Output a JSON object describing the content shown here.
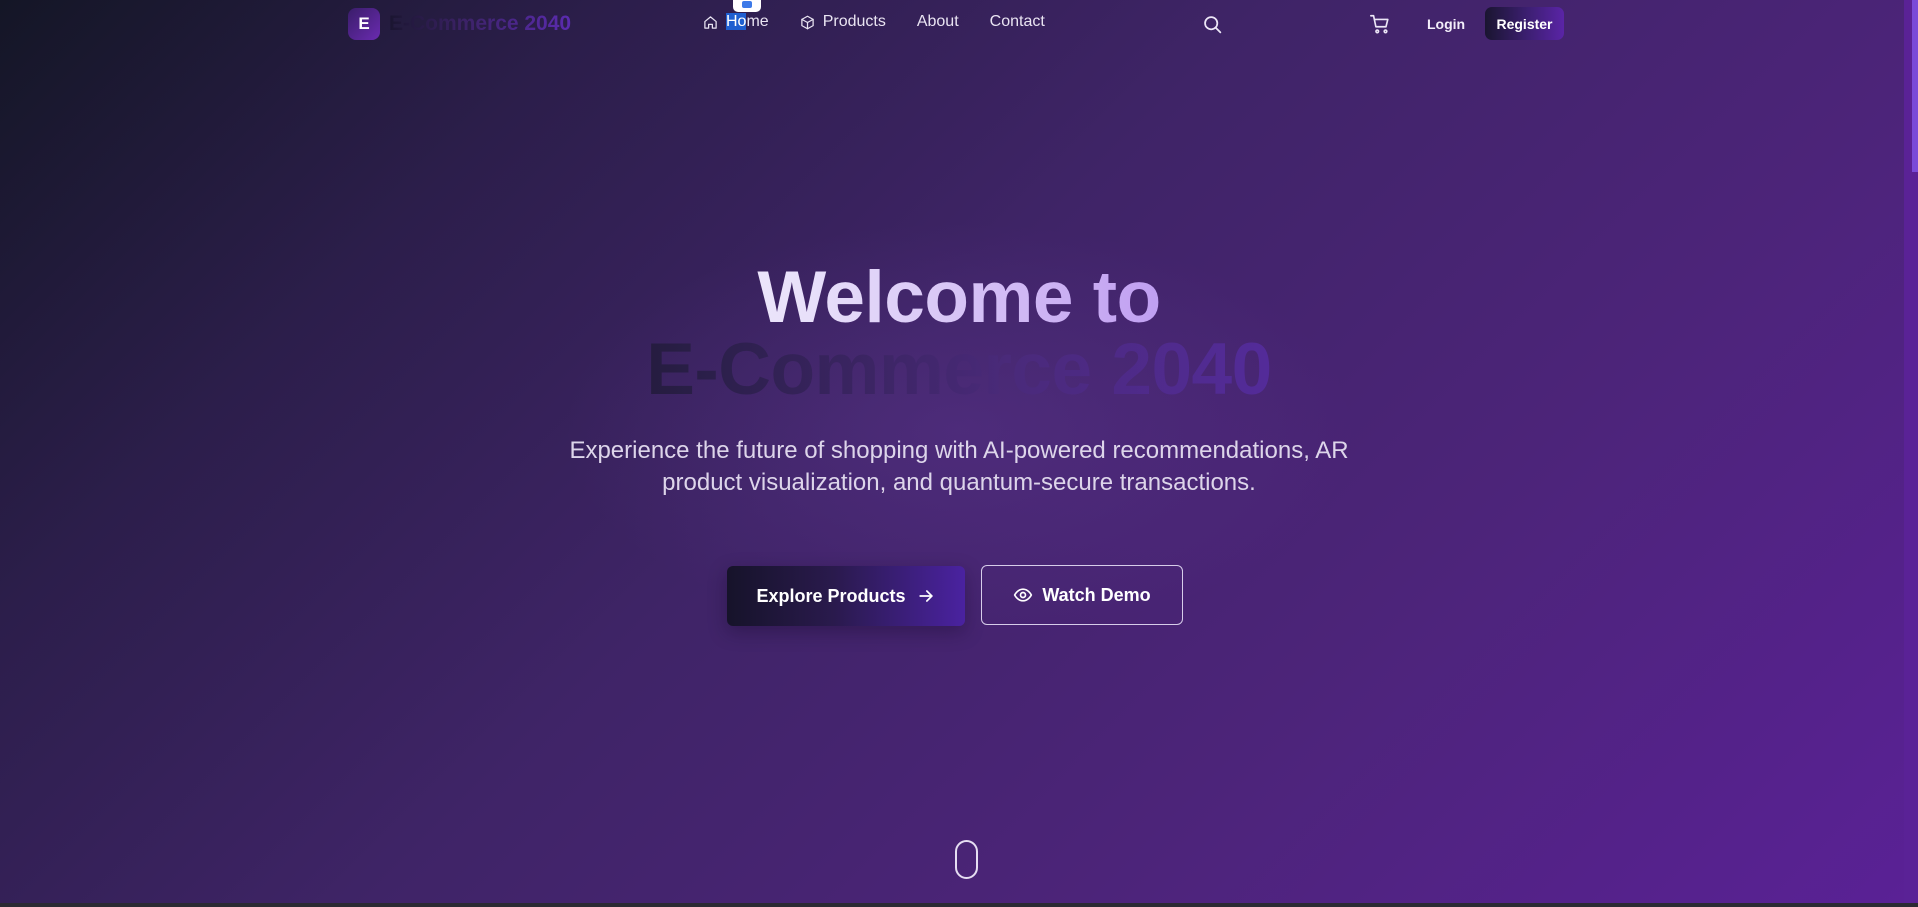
{
  "brand": {
    "badge_letter": "E",
    "name": "E-Commerce 2040"
  },
  "nav": {
    "links": [
      {
        "label": "Home",
        "icon": "home-icon"
      },
      {
        "label": "Products",
        "icon": "box-icon"
      },
      {
        "label": "About"
      },
      {
        "label": "Contact"
      }
    ],
    "home_highlight": "Ho",
    "home_rest": "me",
    "search_icon": "search-icon",
    "cart_icon": "cart-icon",
    "login_label": "Login",
    "register_label": "Register"
  },
  "hero": {
    "title_line1": "Welcome to",
    "title_line2": "E-Commerce 2040",
    "subtitle": "Experience the future of shopping with AI-powered recommendations, AR product visualization, and quantum-secure transactions.",
    "primary_button": "Explore Products",
    "secondary_button": "Watch Demo"
  },
  "colors": {
    "background_start": "#141626",
    "background_end": "#5a2196",
    "accent": "#9a6cf0",
    "text_light": "#ddd5ea"
  }
}
